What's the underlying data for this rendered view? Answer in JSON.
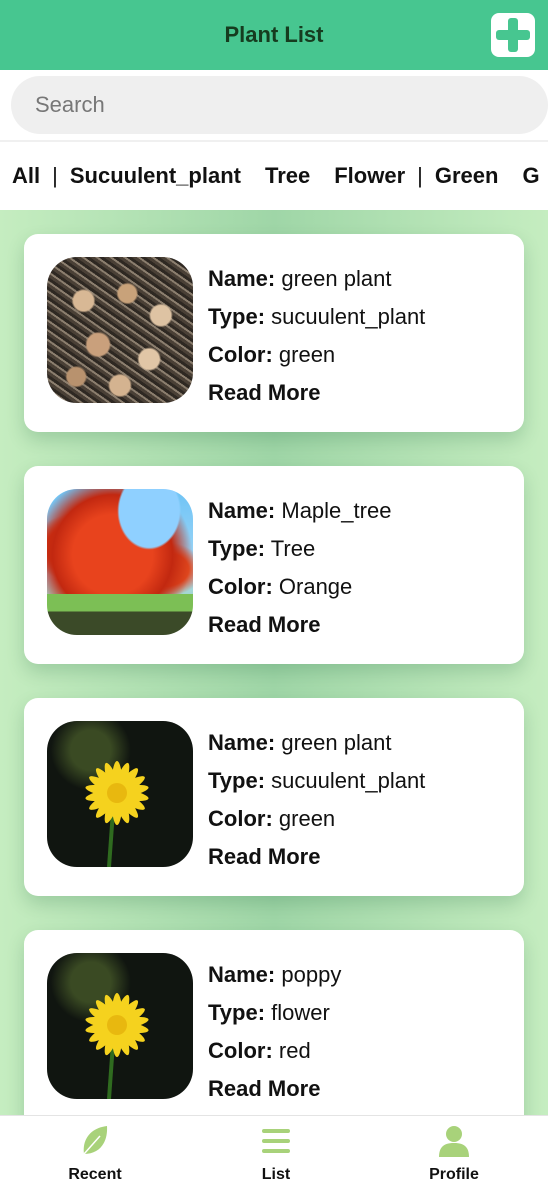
{
  "header": {
    "title": "Plant List",
    "add_icon": "plus-icon"
  },
  "search": {
    "placeholder": "Search",
    "value": ""
  },
  "filters": {
    "items": [
      "All",
      "Sucuulent_plant",
      "Tree",
      "Flower",
      "Green",
      "G"
    ]
  },
  "plants": [
    {
      "name_label": "Name:",
      "name": "green plant",
      "type_label": "Type:",
      "type": "sucuulent_plant",
      "color_label": "Color:",
      "color": "green",
      "read_more": "Read More",
      "image": "succulent"
    },
    {
      "name_label": "Name:",
      "name": "Maple_tree",
      "type_label": "Type:",
      "type": "Tree",
      "color_label": "Color:",
      "color": "Orange",
      "read_more": "Read More",
      "image": "maple"
    },
    {
      "name_label": "Name:",
      "name": "green plant",
      "type_label": "Type:",
      "type": "sucuulent_plant",
      "color_label": "Color:",
      "color": "green",
      "read_more": "Read More",
      "image": "yellow-daisy"
    },
    {
      "name_label": "Name:",
      "name": "poppy",
      "type_label": "Type:",
      "type": "flower",
      "color_label": "Color:",
      "color": "red",
      "read_more": "Read More",
      "image": "yellow-daisy"
    }
  ],
  "tabbar": {
    "tabs": [
      {
        "label": "Recent",
        "icon": "leaf-icon"
      },
      {
        "label": "List",
        "icon": "list-icon"
      },
      {
        "label": "Profile",
        "icon": "person-icon"
      }
    ]
  },
  "colors": {
    "accent": "#47c690",
    "tab_icon": "#a8d27a",
    "background": "#c6ecc0"
  }
}
